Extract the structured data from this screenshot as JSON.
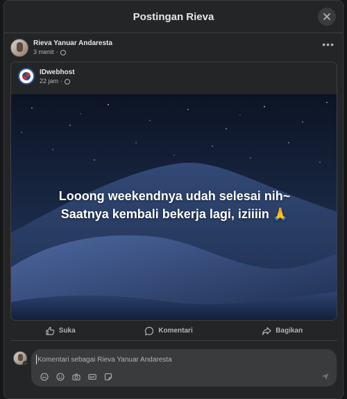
{
  "modal": {
    "title": "Postingan Rieva"
  },
  "post": {
    "author": "Rieva Yanuar Andaresta",
    "time": "3 menit",
    "more_label": "•••"
  },
  "shared_post": {
    "page_name": "IDwebhost",
    "time": "22 jam",
    "image_text_line1": "Looong weekendnya udah selesai nih~",
    "image_text_line2": "Saatnya kembali bekerja lagi, iziiiin 🙏"
  },
  "actions": {
    "like": "Suka",
    "comment": "Komentari",
    "share": "Bagikan"
  },
  "comment_box": {
    "placeholder": "Komentari sebagai Rieva Yanuar Andaresta",
    "tools": [
      "avatar-sticker-icon",
      "emoji-icon",
      "camera-icon",
      "gif-icon",
      "sticker-icon"
    ]
  }
}
